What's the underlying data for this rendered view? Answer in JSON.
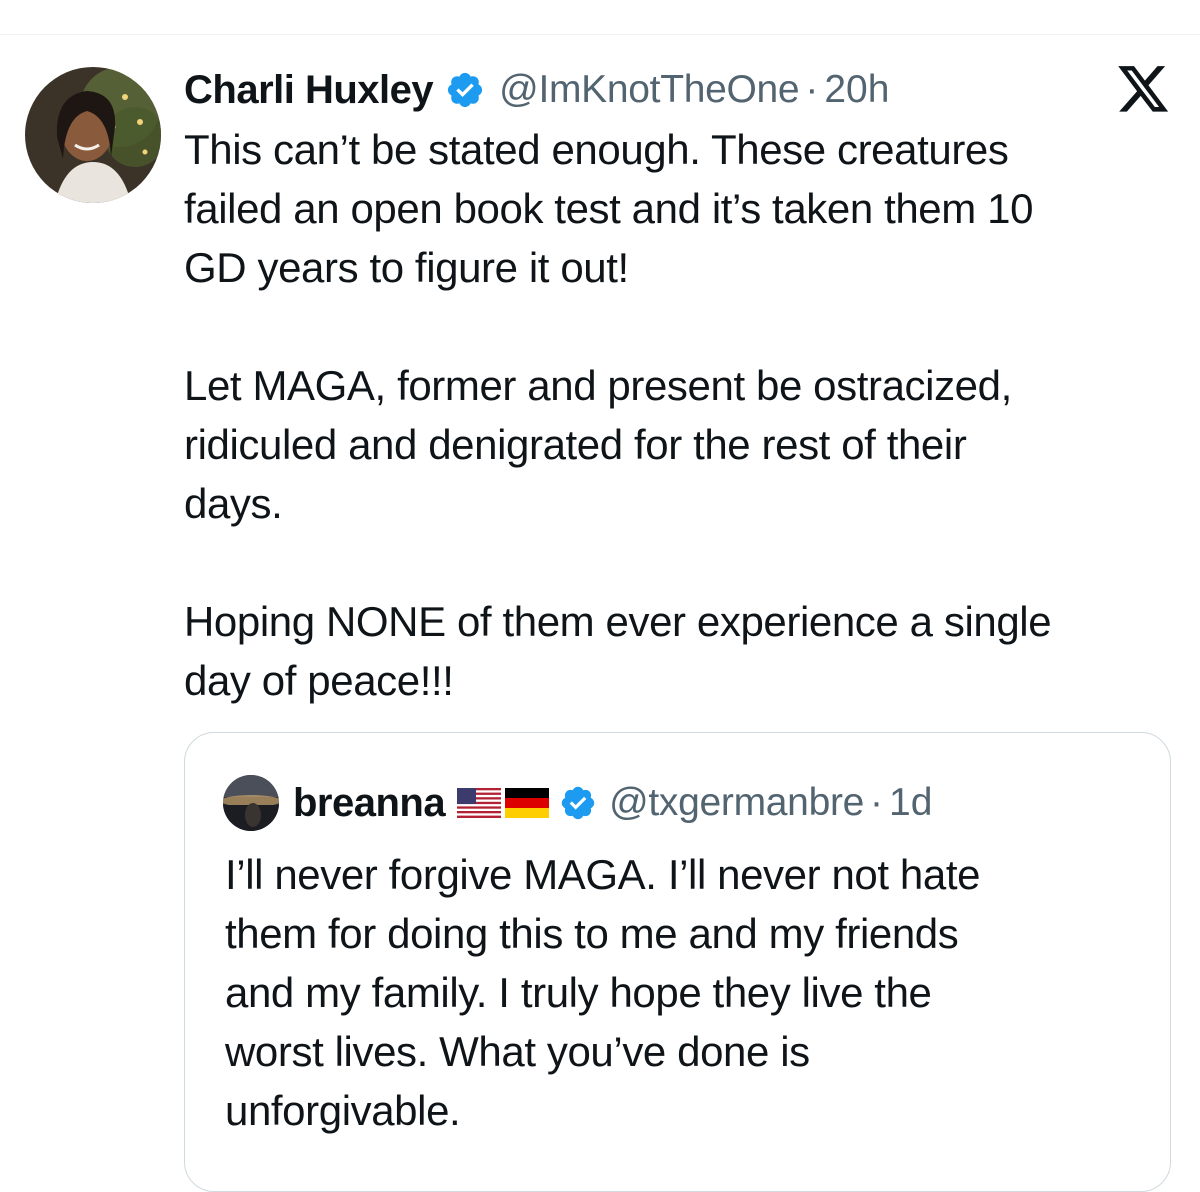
{
  "tweet": {
    "author": {
      "display_name": "Charli Huxley",
      "handle": "@ImKnotTheOne",
      "verified": true,
      "avatar": "profile-photo"
    },
    "separator": "·",
    "time": "20h",
    "platform_icon": "x-logo-icon",
    "paragraphs": [
      "This can’t be stated enough. These creatures\nfailed an open book test and it’s taken them 10\nGD years to figure it out!",
      "Let MAGA, former and present be ostracized,\nridiculed and denigrated for the rest of their\ndays.",
      "Hoping NONE of them ever experience a single\nday of peace!!!"
    ]
  },
  "quoted_tweet": {
    "author": {
      "display_name": "breanna",
      "flags": [
        "us-flag-icon",
        "germany-flag-icon"
      ],
      "verified": true,
      "handle": "@txgermanbre",
      "avatar": "profile-photo"
    },
    "separator": "·",
    "time": "1d",
    "text": "I’ll never forgive MAGA. I’ll never not hate\nthem for doing this to me and my friends\nand my family. I truly hope they live the\nworst lives. What you’ve done is\nunforgivable."
  },
  "colors": {
    "text": "#0f1419",
    "secondary_text": "#536471",
    "verified_blue": "#1d9bf0",
    "border": "#cfd9de"
  }
}
